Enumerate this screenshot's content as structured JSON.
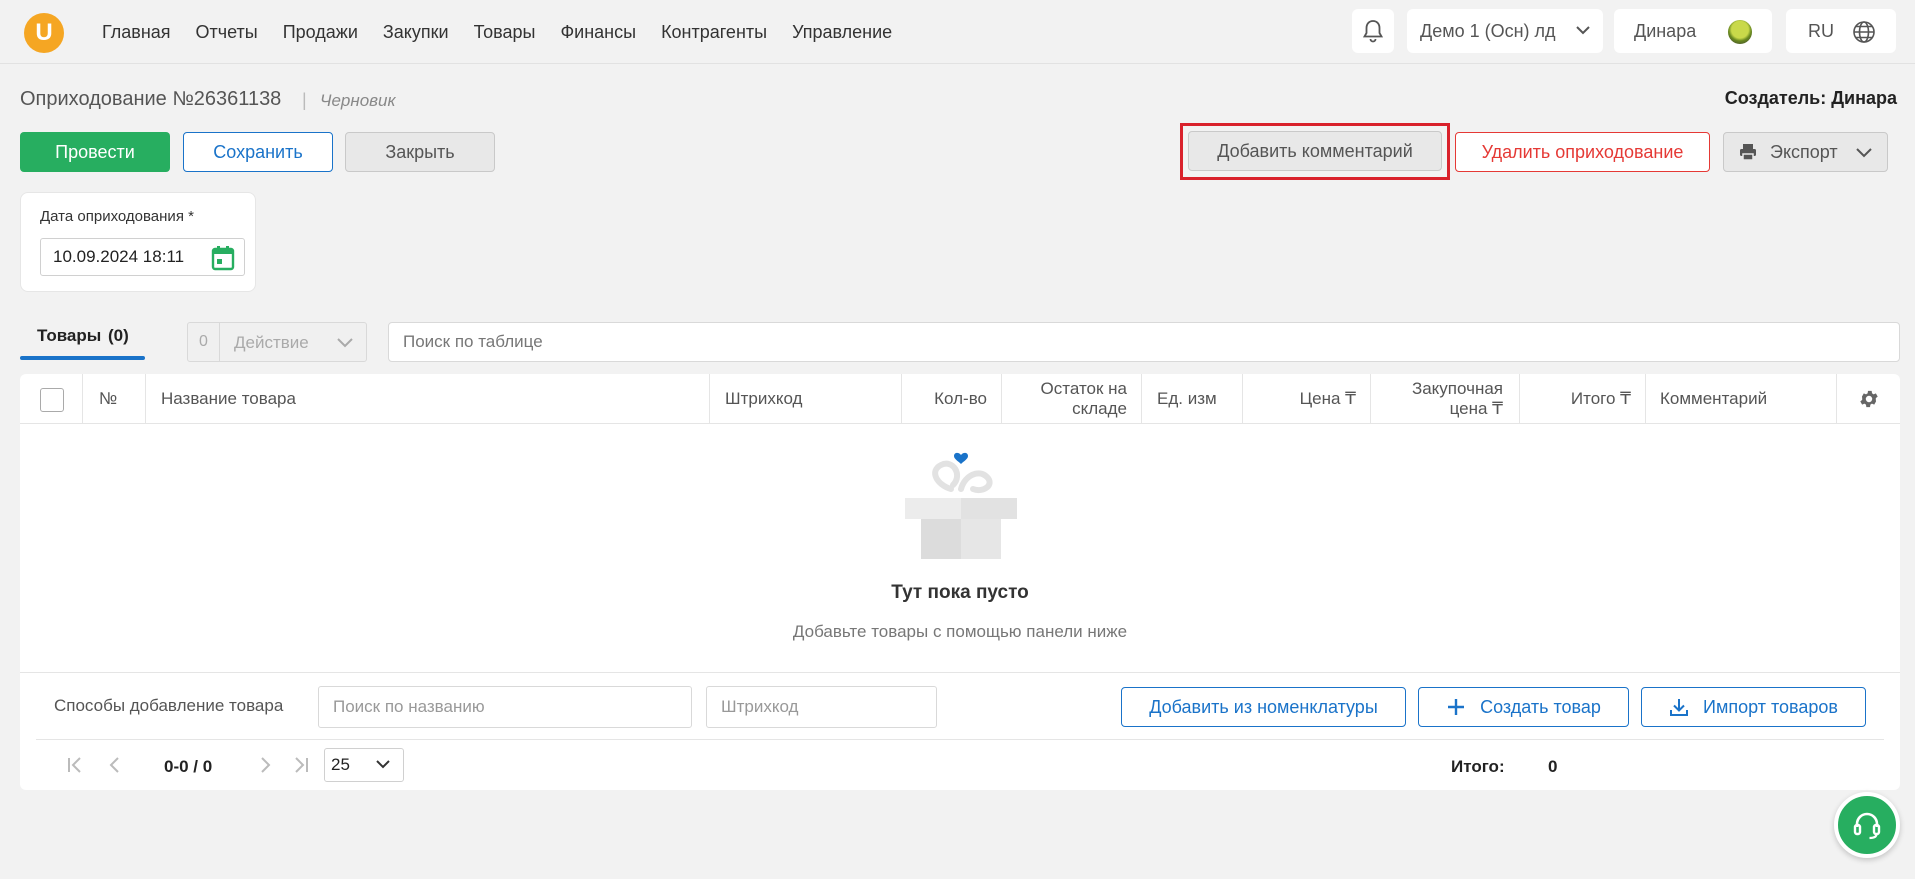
{
  "header": {
    "logo_letter": "U",
    "nav": [
      "Главная",
      "Отчеты",
      "Продажи",
      "Закупки",
      "Товары",
      "Финансы",
      "Контрагенты",
      "Управление"
    ],
    "company": "Демо 1 (Осн) лд",
    "user": "Динара",
    "lang": "RU"
  },
  "doc": {
    "title": "Оприходование №26361138",
    "separator": "|",
    "status": "Черновик",
    "creator": "Создатель: Динара"
  },
  "toolbar": {
    "post": "Провести",
    "save": "Сохранить",
    "close": "Закрыть",
    "add_comment": "Добавить комментарий",
    "delete": "Удалить оприходование",
    "export": "Экспорт"
  },
  "date_field": {
    "label": "Дата оприходования *",
    "value": "10.09.2024 18:11"
  },
  "tabs": {
    "goods": "Товары",
    "goods_count": "(0)",
    "selected_count": "0",
    "action": "Действие",
    "search_placeholder": "Поиск по таблице"
  },
  "table": {
    "columns": {
      "num": "№",
      "name": "Название товара",
      "barcode": "Штрихкод",
      "qty": "Кол-во",
      "stock_1": "Остаток на",
      "stock_2": "складе",
      "unit": "Ед. изм",
      "price": "Цена ₸",
      "purchase_1": "Закупочная",
      "purchase_2": "цена ₸",
      "total": "Итого ₸",
      "comment": "Комментарий"
    },
    "empty_title": "Тут пока пусто",
    "empty_subtitle": "Добавьте товары с помощью панели ниже"
  },
  "add_panel": {
    "label": "Способы добавление товара",
    "search_placeholder": "Поиск по названию",
    "barcode_placeholder": "Штрихкод",
    "from_catalog": "Добавить из номенклатуры",
    "create": "Создать товар",
    "import": "Импорт товаров"
  },
  "pagination": {
    "range": "0-0 / 0",
    "page_size": "25",
    "total_label": "Итого:",
    "total_value": "0"
  },
  "colors": {
    "accent_green": "#27ae60",
    "accent_blue": "#1a73c9",
    "danger": "#e53935",
    "highlight": "#d9212b",
    "logo": "#f5a623"
  }
}
